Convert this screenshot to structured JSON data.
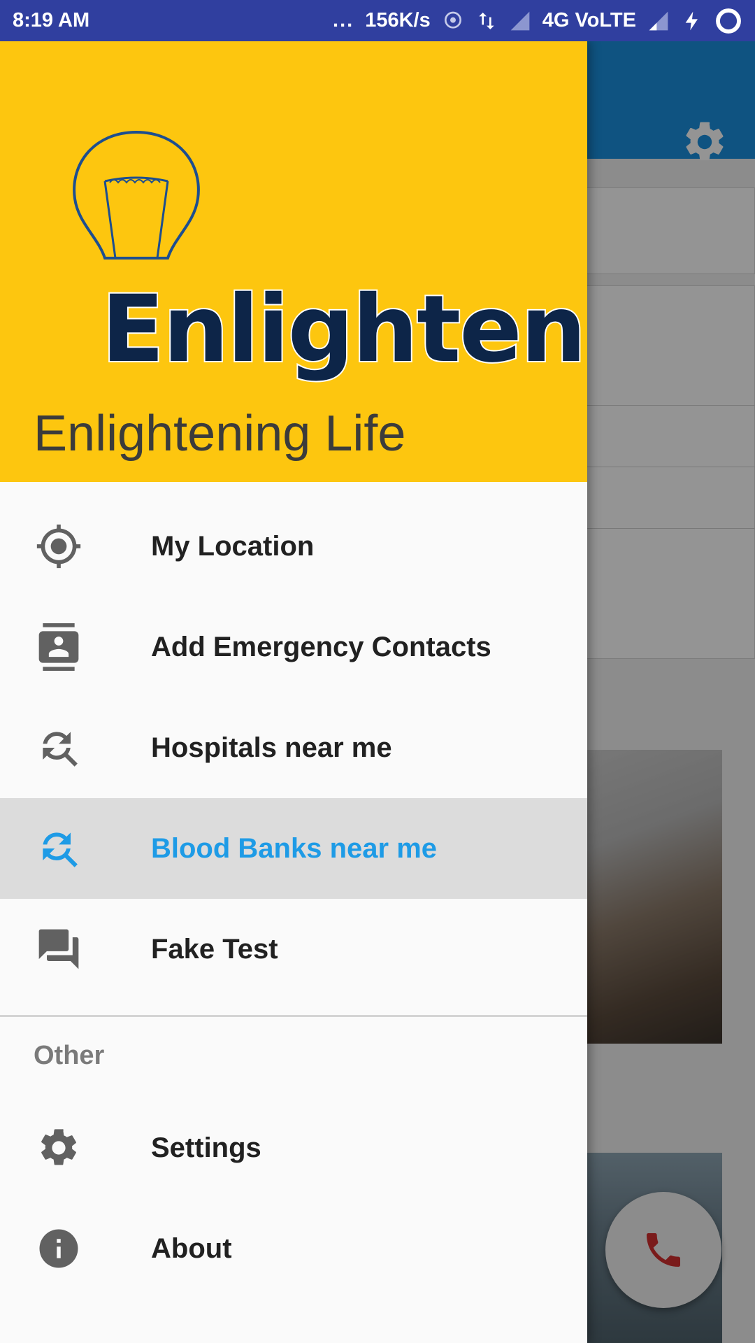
{
  "status_bar": {
    "time": "8:19 AM",
    "dots": "...",
    "speed": "156K/s",
    "network": "4G VoLTE"
  },
  "background": {
    "rows": [
      "532",
      "335",
      "957"
    ]
  },
  "drawer": {
    "logo_text": "Enlighten",
    "header_title": "Enlightening Life",
    "items": [
      {
        "label": "My Location",
        "icon": "my-location-icon"
      },
      {
        "label": "Add Emergency Contacts",
        "icon": "contacts-icon"
      },
      {
        "label": "Hospitals near me",
        "icon": "find-replace-icon"
      },
      {
        "label": "Blood Banks near me",
        "icon": "find-replace-icon",
        "active": true
      },
      {
        "label": "Fake Test",
        "icon": "forum-icon"
      }
    ],
    "section_other": "Other",
    "other_items": [
      {
        "label": "Settings",
        "icon": "gear-icon"
      },
      {
        "label": "About",
        "icon": "info-icon"
      }
    ]
  },
  "colors": {
    "status_bar": "#303f9f",
    "header": "#fdc60f",
    "active_text": "#1e9be6",
    "toolbar": "#1a8fde"
  }
}
